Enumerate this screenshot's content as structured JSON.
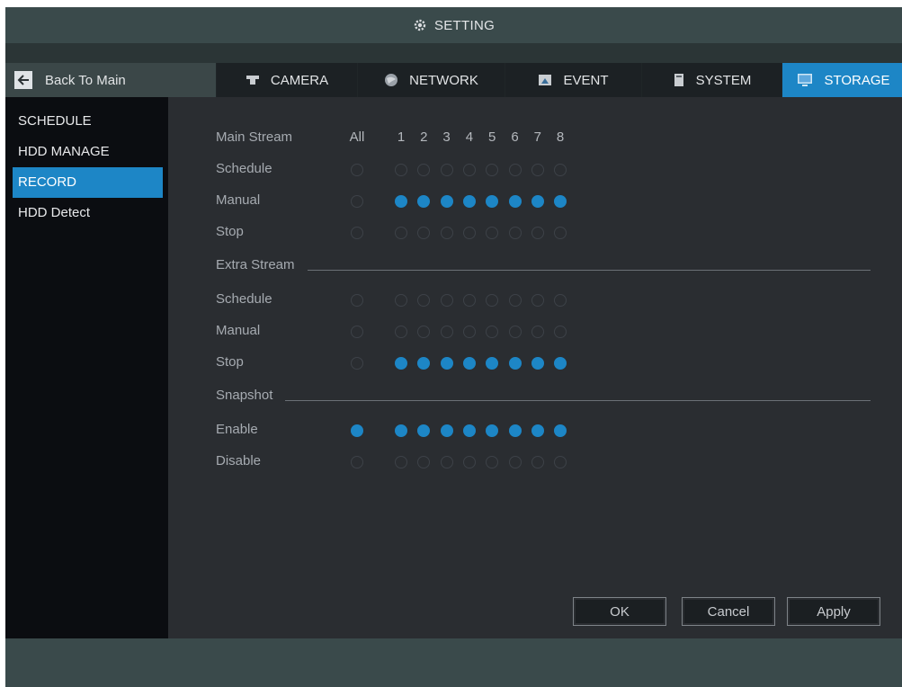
{
  "title": "SETTING",
  "nav": {
    "back_label": "Back To Main",
    "tabs": [
      {
        "label": "CAMERA",
        "icon": "camera-icon"
      },
      {
        "label": "NETWORK",
        "icon": "globe-icon"
      },
      {
        "label": "EVENT",
        "icon": "event-icon"
      },
      {
        "label": "SYSTEM",
        "icon": "system-icon"
      },
      {
        "label": "STORAGE",
        "icon": "monitor-icon"
      }
    ],
    "active_tab": "STORAGE"
  },
  "sidebar": {
    "items": [
      {
        "label": "SCHEDULE"
      },
      {
        "label": "HDD MANAGE"
      },
      {
        "label": "RECORD"
      },
      {
        "label": "HDD Detect"
      }
    ],
    "active": "RECORD"
  },
  "record": {
    "main_stream_label": "Main Stream",
    "all_label": "All",
    "channels": [
      "1",
      "2",
      "3",
      "4",
      "5",
      "6",
      "7",
      "8"
    ],
    "main_stream": [
      {
        "label": "Schedule",
        "all": false,
        "channels": [
          false,
          false,
          false,
          false,
          false,
          false,
          false,
          false
        ]
      },
      {
        "label": "Manual",
        "all": false,
        "channels": [
          true,
          true,
          true,
          true,
          true,
          true,
          true,
          true
        ]
      },
      {
        "label": "Stop",
        "all": false,
        "channels": [
          false,
          false,
          false,
          false,
          false,
          false,
          false,
          false
        ]
      }
    ],
    "extra_stream_label": "Extra Stream",
    "extra_stream": [
      {
        "label": "Schedule",
        "all": false,
        "channels": [
          false,
          false,
          false,
          false,
          false,
          false,
          false,
          false
        ]
      },
      {
        "label": "Manual",
        "all": false,
        "channels": [
          false,
          false,
          false,
          false,
          false,
          false,
          false,
          false
        ]
      },
      {
        "label": "Stop",
        "all": false,
        "channels": [
          true,
          true,
          true,
          true,
          true,
          true,
          true,
          true
        ]
      }
    ],
    "snapshot_label": "Snapshot",
    "snapshot": [
      {
        "label": "Enable",
        "all": true,
        "channels": [
          true,
          true,
          true,
          true,
          true,
          true,
          true,
          true
        ]
      },
      {
        "label": "Disable",
        "all": false,
        "channels": [
          false,
          false,
          false,
          false,
          false,
          false,
          false,
          false
        ]
      }
    ]
  },
  "buttons": {
    "ok": "OK",
    "cancel": "Cancel",
    "apply": "Apply"
  },
  "colors": {
    "accent": "#1d86c6",
    "header_bar": "#3a4a4b",
    "panel": "#2a2d31"
  }
}
